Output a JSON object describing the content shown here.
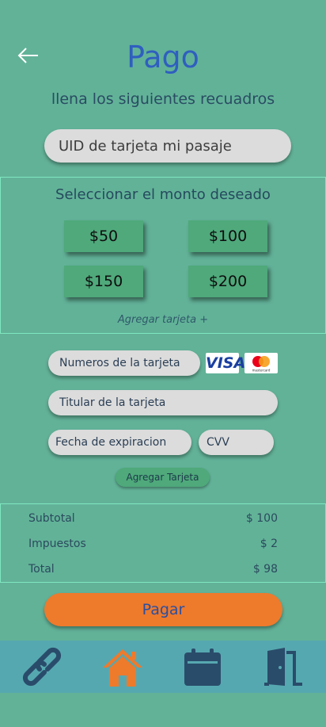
{
  "header": {
    "title": "Pago",
    "subtitle": "llena los siguientes recuadros"
  },
  "uid_field": {
    "placeholder": "UID de tarjeta mi pasaje",
    "value": ""
  },
  "amount_section": {
    "title": "Seleccionar el monto deseado",
    "amounts": [
      "$50",
      "$100",
      "$150",
      "$200"
    ],
    "add_card_link": "Agregar tarjeta +"
  },
  "card_form": {
    "number_placeholder": "Numeros de la tarjeta",
    "holder_placeholder": "Titular de la tarjeta",
    "expiry_placeholder": "Fecha de expiracion",
    "cvv_placeholder": "CVV",
    "visa_label": "VISA",
    "mastercard_label": "mastercard",
    "add_card_button": "Agregar Tarjeta"
  },
  "summary": {
    "rows": [
      {
        "label": "Subtotal",
        "value": "$ 100"
      },
      {
        "label": "Impuestos",
        "value": "$ 2"
      },
      {
        "label": "Total",
        "value": "$ 98"
      }
    ]
  },
  "pay_button": "Pagar",
  "bottom_nav": {
    "items": [
      "link-icon",
      "home-icon",
      "calendar-icon",
      "door-exit-icon"
    ]
  },
  "colors": {
    "background": "#62b298",
    "accent_orange": "#ee7a2c",
    "title_blue": "#2f5fbf",
    "amount_button": "#4fa97b",
    "nav_bar": "#56a8b0",
    "nav_icon": "#2a4c6b"
  }
}
